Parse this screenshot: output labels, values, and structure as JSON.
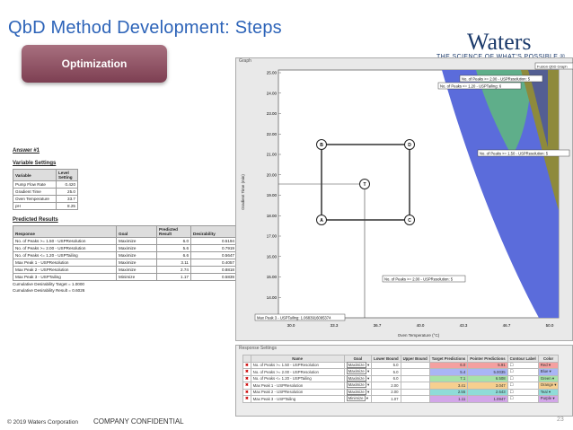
{
  "slide": {
    "title": "QbD Method Development: Steps",
    "brand": "Waters",
    "tagline": "THE SCIENCE OF WHAT'S POSSIBLE.®",
    "step_button": "Optimization",
    "footer_copyright": "© 2019 Waters Corporation",
    "footer_confidential": "COMPANY CONFIDENTIAL",
    "page_number": "23"
  },
  "answer": {
    "heading": "Answer #1",
    "variable_settings_heading": "Variable Settings",
    "variable_headers": [
      "Variable",
      "Level Setting"
    ],
    "variables": [
      {
        "name": "Pump Flow Rate",
        "value": "0.420"
      },
      {
        "name": "Gradient Time",
        "value": "25.0"
      },
      {
        "name": "Oven Temperature",
        "value": "33.7"
      },
      {
        "name": "pH",
        "value": "8.25"
      }
    ],
    "predicted_heading": "Predicted Results",
    "predicted_headers": [
      "Response",
      "Goal",
      "Predicted Result",
      "Desirability"
    ],
    "predicted": [
      {
        "response": "No. of Peaks >= 1.50 - USPResolution",
        "goal": "Maximize",
        "result": "6.0",
        "desirability": "0.5194"
      },
      {
        "response": "No. of Peaks >= 2.00 - USPResolution",
        "goal": "Maximize",
        "result": "5.6",
        "desirability": "0.7919"
      },
      {
        "response": "No. of Peaks <= 1.20 - USPTailing",
        "goal": "Maximize",
        "result": "6.6",
        "desirability": "0.5647"
      },
      {
        "response": "Max Peak 1 - USPResolution",
        "goal": "Maximize",
        "result": "3.11",
        "desirability": "0.4057"
      },
      {
        "response": "Max Peak 2 - USPResolution",
        "goal": "Maximize",
        "result": "2.74",
        "desirability": "0.8818"
      },
      {
        "response": "Max Peak 3 - USPTailing",
        "goal": "Minimize",
        "result": "1.17",
        "desirability": "0.5839"
      }
    ],
    "cumulative_target": "Cumulative Desirability Target = 1.0000",
    "cumulative_result": "Cumulative Desirability Result = 0.6026"
  },
  "graph": {
    "window_label": "Graph",
    "legend_label": "Fusion QbD Graph",
    "ylabel": "Gradient Time (min)",
    "xlabel": "Oven Temperature (°C)",
    "y_ticks": [
      "25.00",
      "24.00",
      "23.00",
      "22.00",
      "21.00",
      "20.00",
      "19.00",
      "18.00",
      "17.00",
      "16.00",
      "15.00",
      "14.00"
    ],
    "x_ticks": [
      "30.0",
      "33.3",
      "36.7",
      "40.0",
      "43.3",
      "46.7",
      "50.0"
    ],
    "points": [
      "B",
      "D",
      "T",
      "A",
      "C"
    ],
    "callouts": [
      "No. of Peaks >= 2.00 - USPResolution: 5",
      "No. of Peaks <= 1.20 - USPTailing: 6",
      "No. of Peaks >= 1.50 - USPResolution: 5",
      "No. of Peaks >= 2.00 - USPResolution: 5",
      "Max Peak 3 - USPTailing: 1.0683916095374"
    ],
    "colors": {
      "blue_region": "#5b6cdb",
      "green_region": "#5fae8a",
      "olive_region": "#8e8a3c",
      "white_region": "#ffffff"
    }
  },
  "response_settings": {
    "window_label": "Response Settings",
    "headers": [
      "Name",
      "Goal",
      "Lower Bound",
      "Upper Bound",
      "Target Predictions",
      "Pointer Predictions",
      "Contour Label",
      "Color"
    ],
    "rows": [
      {
        "name": "No. of Peaks >= 1.50 - USPResolution",
        "goal": "Maximize",
        "lower": "5.0",
        "target": "6.0",
        "pointer": "5.91",
        "color": "Red",
        "swatch": "#f4a0a0"
      },
      {
        "name": "No. of Peaks >= 2.00 - USPResolution",
        "goal": "Maximize",
        "lower": "5.0",
        "target": "5.4",
        "pointer": "5.0035",
        "color": "Blue",
        "swatch": "#a9b5f5"
      },
      {
        "name": "No. of Peaks <= 1.20 - USPTailing",
        "goal": "Maximize",
        "lower": "6.0",
        "target": "7.1",
        "pointer": "6.508",
        "color": "Green",
        "swatch": "#a7e3a7"
      },
      {
        "name": "Max Peak 1 - USPResolution",
        "goal": "Maximize",
        "lower": "2.00",
        "target": "3.41",
        "pointer": "3.047",
        "color": "Orange",
        "swatch": "#f6cf8f"
      },
      {
        "name": "Max Peak 2 - USPResolution",
        "goal": "Maximize",
        "lower": "2.00",
        "target": "2.55",
        "pointer": "2.643",
        "color": "Teal",
        "swatch": "#8fdcd8"
      },
      {
        "name": "Max Peak 3 - USPTailing",
        "goal": "Minimize",
        "lower": "1.07",
        "target": "1.11",
        "pointer": "1.0947",
        "color": "Purple",
        "swatch": "#d2a6e8"
      }
    ]
  }
}
